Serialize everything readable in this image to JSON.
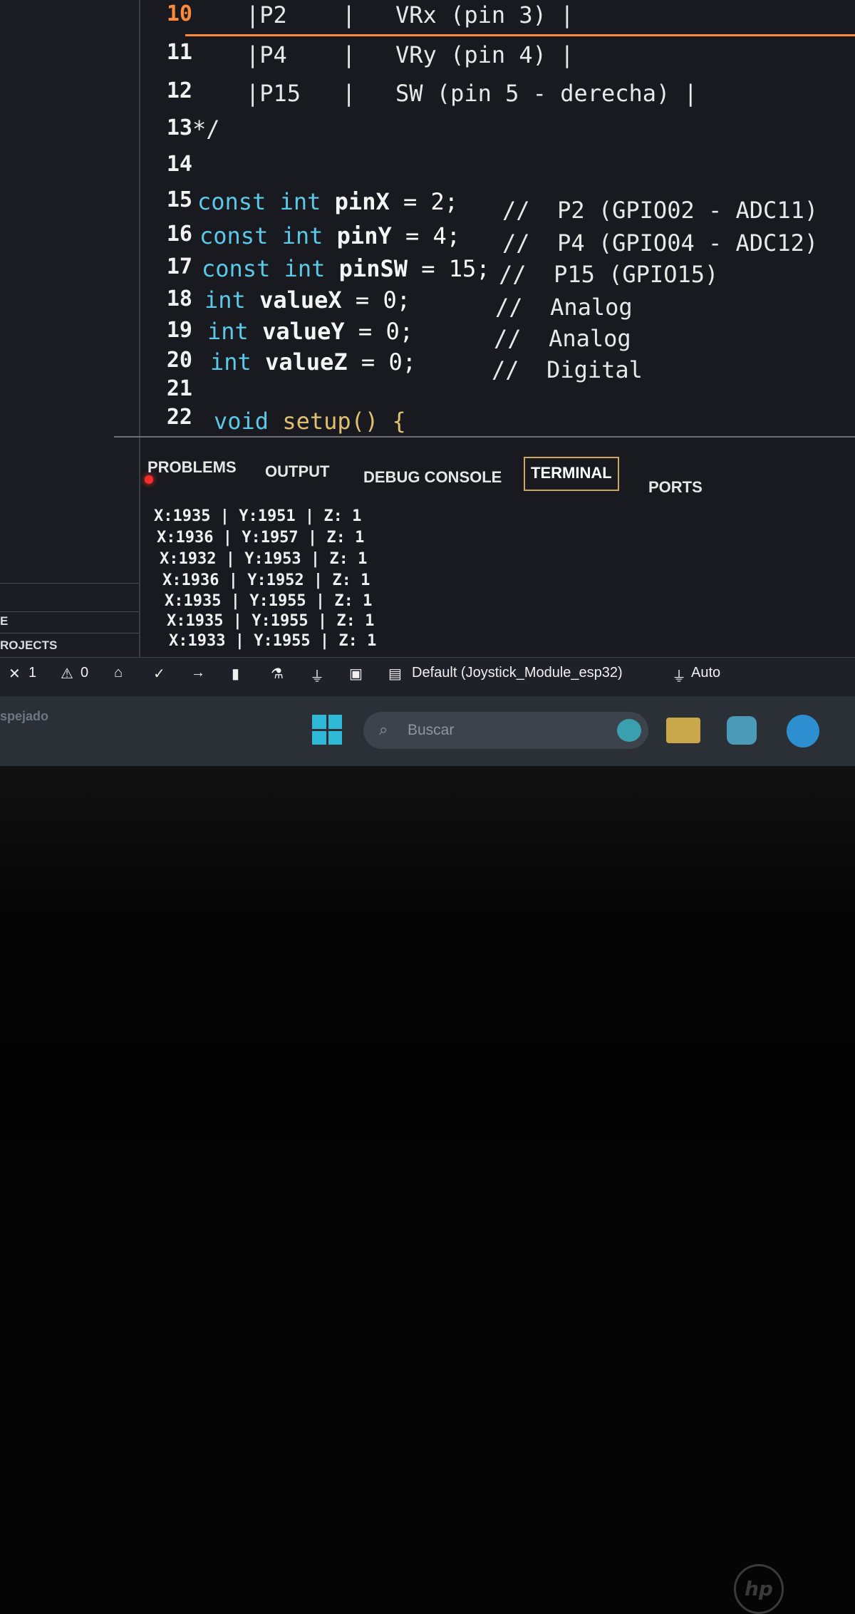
{
  "editor": {
    "line_numbers": [
      "10",
      "11",
      "12",
      "13",
      "14",
      "15",
      "16",
      "17",
      "18",
      "19",
      "20",
      "21",
      "22"
    ],
    "lines": {
      "l10_a": "|P2",
      "l10_b": "|",
      "l10_c": "VRx (pin 3) |",
      "l11_a": "|P4",
      "l11_b": "|",
      "l11_c": "VRy (pin 4) |",
      "l12_a": "|P15",
      "l12_b": "|",
      "l12_c": "SW (pin 5 - derecha) |",
      "l13": "*/",
      "l15_kw1": "const",
      "l15_kw2": "int",
      "l15_id": "pinX",
      "l15_rest": " = 2;",
      "l15_cm": "//  P2 (GPIO02 - ADC11)",
      "l16_kw1": "const",
      "l16_kw2": "int",
      "l16_id": "pinY",
      "l16_rest": " = 4;",
      "l16_cm": "//  P4 (GPIO04 - ADC12)",
      "l17_kw1": "const",
      "l17_kw2": "int",
      "l17_id": "pinSW",
      "l17_rest": " = 15;",
      "l17_cm": "//  P15 (GPIO15)",
      "l18_kw": "int",
      "l18_id": "valueX",
      "l18_rest": " = 0;",
      "l18_cm": "//  Analog",
      "l19_kw": "int",
      "l19_id": "valueY",
      "l19_rest": " = 0;",
      "l19_cm": "//  Analog",
      "l20_kw": "int",
      "l20_id": "valueZ",
      "l20_rest": " = 0;",
      "l20_cm": "//  Digital",
      "l22_kw": "void",
      "l22_fn": "setup()",
      "l22_brace": " {"
    }
  },
  "panel": {
    "tabs": [
      "PROBLEMS",
      "OUTPUT",
      "DEBUG CONSOLE",
      "TERMINAL",
      "PORTS"
    ],
    "active_tab": "TERMINAL",
    "terminal_lines": [
      "X:1935 | Y:1951 | Z: 1",
      "X:1936 | Y:1957 | Z: 1",
      "X:1932 | Y:1953 | Z: 1",
      "X:1936 | Y:1952 | Z: 1",
      "X:1935 | Y:1955 | Z: 1",
      "X:1935 | Y:1955 | Z: 1",
      "X:1933 | Y:1955 | Z: 1"
    ]
  },
  "sidebar": {
    "label_1": "E",
    "label_2": "ROJECTS"
  },
  "status_bar": {
    "errors_count": "1",
    "warnings_count": "0",
    "project": "Default (Joystick_Module_esp32)",
    "port": "Auto",
    "left_text": "spejado"
  },
  "taskbar": {
    "search_placeholder": "Buscar"
  },
  "device": {
    "brand": "hp"
  },
  "colors": {
    "editor_bg": "#181a1f",
    "keyword": "#5bc8e8",
    "function": "#e0c070",
    "current_line": "#ff8a3a",
    "active_tab_border": "#cfa860"
  }
}
